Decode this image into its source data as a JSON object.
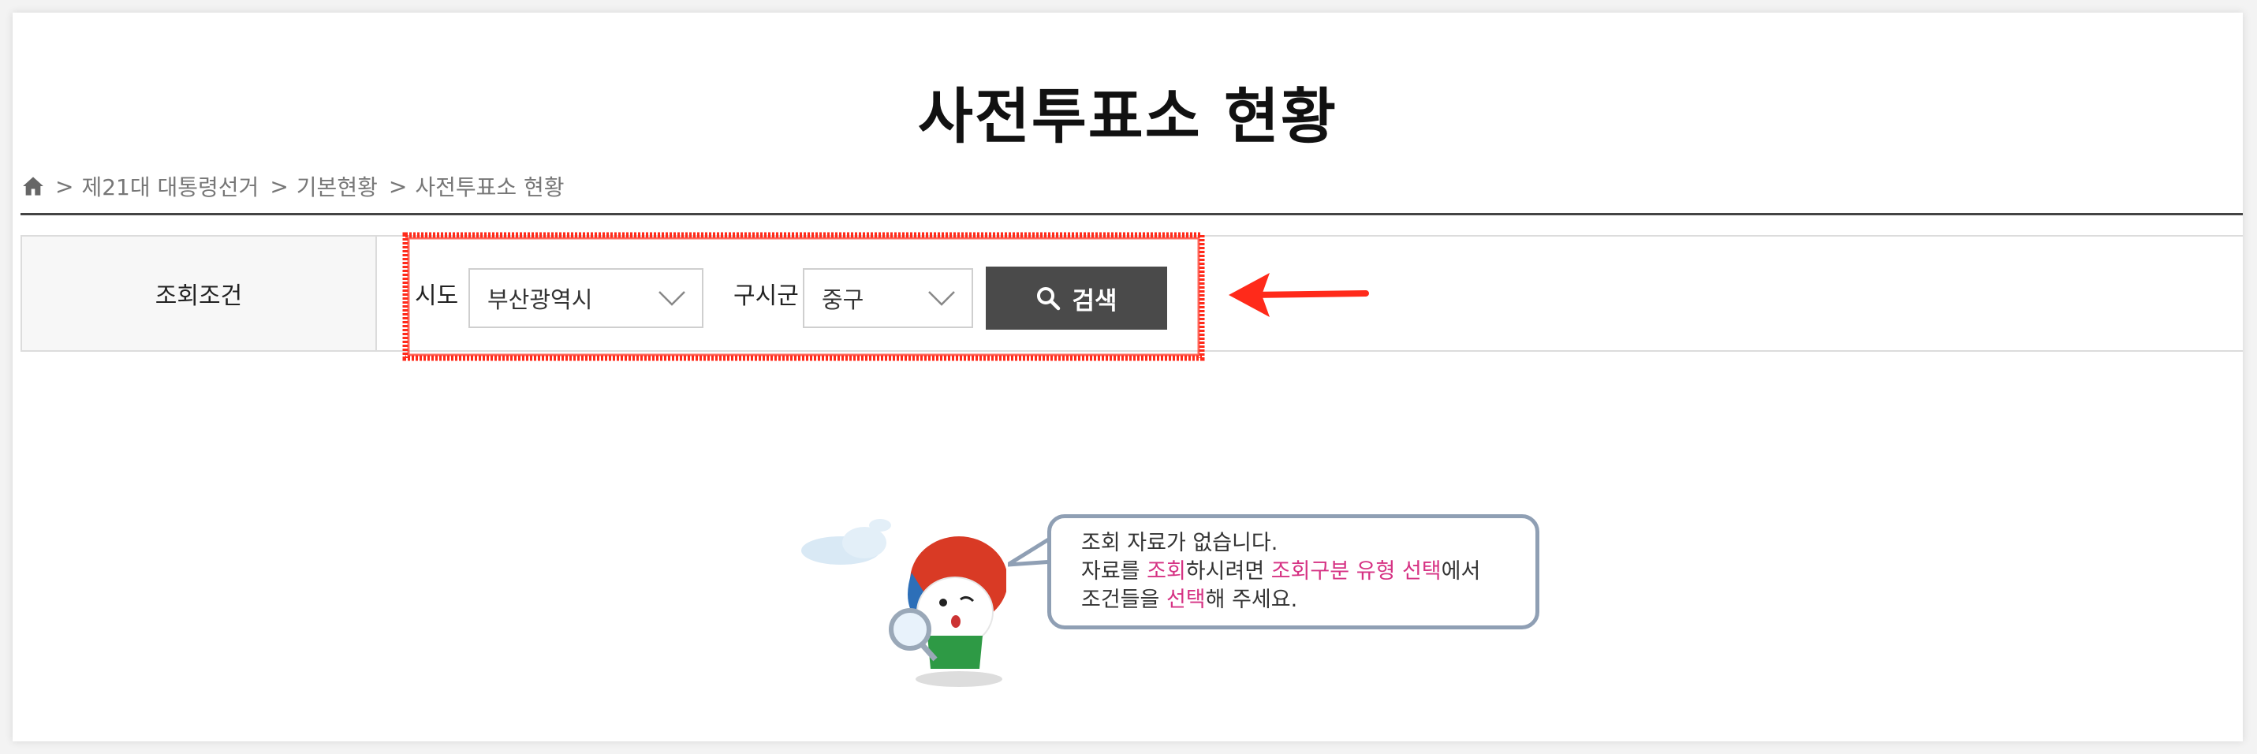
{
  "page": {
    "title": "사전투표소 현황"
  },
  "breadcrumb": {
    "home_icon": "home-icon",
    "separator": ">",
    "items": [
      "제21대 대통령선거",
      "기본현황",
      "사전투표소 현황"
    ]
  },
  "search": {
    "section_label": "조회조건",
    "sido_label": "시도",
    "sido_value": "부산광역시",
    "sigungu_label": "구시군",
    "sigungu_value": "중구",
    "button_label": "검색",
    "button_icon": "search-icon"
  },
  "empty_state": {
    "line1": "조회 자료가 없습니다.",
    "line2_a": "자료를 ",
    "line2_hl1": "조회",
    "line2_b": "하시려면 ",
    "line2_hl2": "조회구분 유형 선택",
    "line2_c": "에서",
    "line3_a": "조건들을 ",
    "line3_hl": "선택",
    "line3_b": "해 주세요."
  },
  "colors": {
    "annotation_red": "#ff2a1a",
    "highlight_pink": "#d63384",
    "button_bg": "#4a4a4a",
    "bubble_border": "#8f9fb4"
  }
}
